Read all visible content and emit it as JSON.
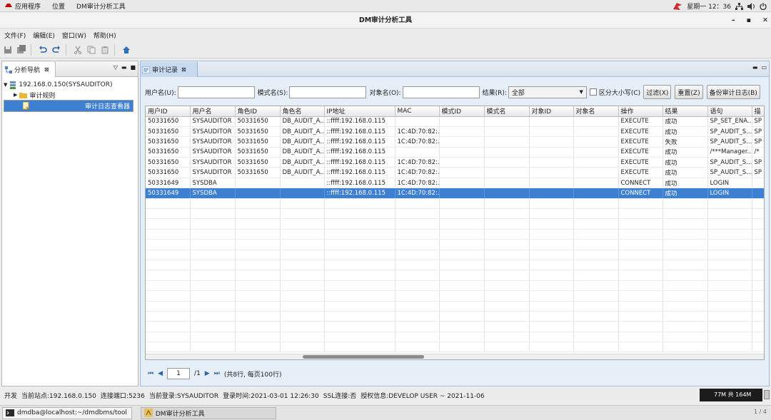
{
  "topbar": {
    "apps": "应用程序",
    "places": "位置",
    "current_app": "DM审计分析工具",
    "clock": "星期一 12：36"
  },
  "window": {
    "title": "DM审计分析工具"
  },
  "menu": [
    "文件(F)",
    "编辑(E)",
    "窗口(W)",
    "帮助(H)"
  ],
  "navigator": {
    "tab_label": "分析导航",
    "server": "192.168.0.150(SYSAUDITOR)",
    "rules": "审计规则",
    "viewer": "审计日志查看器"
  },
  "audit": {
    "tab_label": "审计记录",
    "filters": {
      "user_label": "用户名(U):",
      "schema_label": "模式名(S):",
      "object_label": "对象名(O):",
      "result_label": "结果(R):",
      "result_value": "全部",
      "case_label": "区分大小写(C)",
      "filter_btn": "过滤(X)",
      "reset_btn": "重置(Z)",
      "backup_btn": "备份审计日志(B)"
    },
    "columns": [
      "用户ID",
      "用户名",
      "角色ID",
      "角色名",
      "IP地址",
      "MAC",
      "模式ID",
      "模式名",
      "对象ID",
      "对象名",
      "操作",
      "结果",
      "语句",
      "描"
    ],
    "rows": [
      [
        "50331650",
        "SYSAUDITOR",
        "50331650",
        "DB_AUDIT_A...",
        "::ffff:192.168.0.115",
        "",
        "",
        "",
        "",
        "",
        "EXECUTE",
        "成功",
        "SP_SET_ENA...",
        "SP"
      ],
      [
        "50331650",
        "SYSAUDITOR",
        "50331650",
        "DB_AUDIT_A...",
        "::ffff:192.168.0.115",
        "1C:4D:70:82:...",
        "",
        "",
        "",
        "",
        "EXECUTE",
        "成功",
        "SP_AUDIT_S...",
        "SP"
      ],
      [
        "50331650",
        "SYSAUDITOR",
        "50331650",
        "DB_AUDIT_A...",
        "::ffff:192.168.0.115",
        "1C:4D:70:82:...",
        "",
        "",
        "",
        "",
        "EXECUTE",
        "失败",
        "SP_AUDIT_S...",
        "SP"
      ],
      [
        "50331650",
        "SYSAUDITOR",
        "50331650",
        "DB_AUDIT_A...",
        "::ffff:192.168.0.115",
        "",
        "",
        "",
        "",
        "",
        "EXECUTE",
        "成功",
        "/***Manager...",
        "/*"
      ],
      [
        "50331650",
        "SYSAUDITOR",
        "50331650",
        "DB_AUDIT_A...",
        "::ffff:192.168.0.115",
        "1C:4D:70:82:...",
        "",
        "",
        "",
        "",
        "EXECUTE",
        "成功",
        "SP_AUDIT_S...",
        "SP"
      ],
      [
        "50331650",
        "SYSAUDITOR",
        "50331650",
        "DB_AUDIT_A...",
        "::ffff:192.168.0.115",
        "1C:4D:70:82:...",
        "",
        "",
        "",
        "",
        "EXECUTE",
        "成功",
        "SP_AUDIT_S...",
        "SP"
      ],
      [
        "50331649",
        "SYSDBA",
        "",
        "",
        "::ffff:192.168.0.115",
        "1C:4D:70:82:...",
        "",
        "",
        "",
        "",
        "CONNECT",
        "成功",
        "LOGIN",
        ""
      ],
      [
        "50331649",
        "SYSDBA",
        "",
        "",
        "::ffff:192.168.0.115",
        "1C:4D:70:82:...",
        "",
        "",
        "",
        "",
        "CONNECT",
        "成功",
        "LOGIN",
        ""
      ]
    ],
    "selected_row": 7,
    "pager": {
      "page": "1",
      "total_pages": "/1",
      "summary": "(共8行, 每页100行)"
    }
  },
  "status": {
    "mode": "开发",
    "site": "当前站点:192.168.0.150",
    "port": "连接端口:5236",
    "login": "当前登录:SYSAUDITOR",
    "login_time": "登录时间:2021-03-01 12:26:30",
    "ssl": "SSL连接:否",
    "license": "授权信息:DEVELOP USER ~ 2021-11-06",
    "memory": "77M 共 164M"
  },
  "taskbar": {
    "terminal": "dmdba@localhost:~/dmdbms/tool",
    "app": "DM审计分析工具",
    "page": "1 / 4"
  },
  "colors": {
    "selection": "#3d7fd1",
    "panel_border": "#9fbde0",
    "tab_active": "#c7daf0"
  }
}
